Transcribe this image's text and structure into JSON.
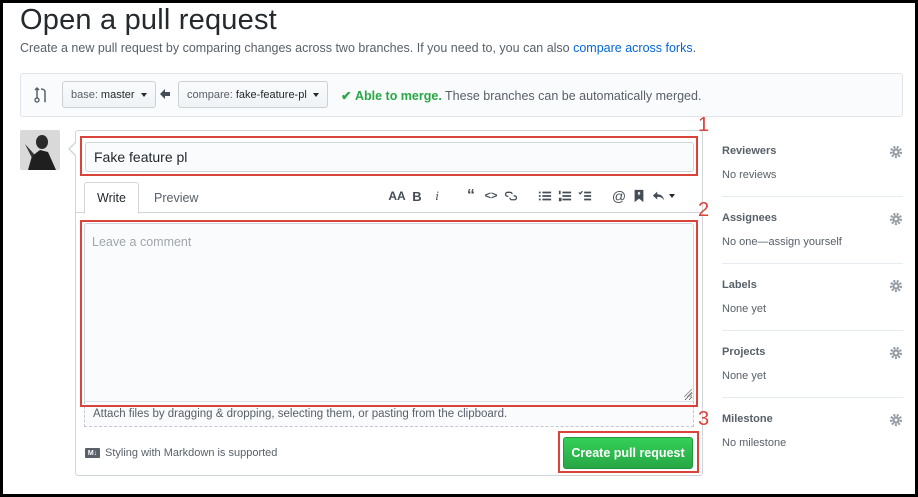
{
  "header": {
    "title": "Open a pull request",
    "subtitle": "Create a new pull request by comparing changes across two branches. If you need to, you can also ",
    "subtitle_link": "compare across forks",
    "subtitle_end": "."
  },
  "compare": {
    "base_prefix": "base:",
    "base_branch": "master",
    "compare_prefix": "compare:",
    "compare_branch": "fake-feature-pl",
    "merge_ok": "Able to merge.",
    "merge_msg": "These branches can be automatically merged."
  },
  "form": {
    "title_value": "Fake feature pl",
    "tabs": [
      {
        "label": "Write"
      },
      {
        "label": "Preview"
      }
    ],
    "comment_placeholder": "Leave a comment",
    "attach_text": "Attach files by dragging & dropping, selecting them, or pasting from the clipboard.",
    "markdown_note": "Styling with Markdown is supported",
    "submit_label": "Create pull request",
    "toolbar": [
      "header-icon",
      "bold-icon",
      "italic-icon",
      "quote-icon",
      "code-icon",
      "link-icon",
      "bulleted-list-icon",
      "numbered-list-icon",
      "task-list-icon",
      "mention-icon",
      "bookmark-icon",
      "reply-icon"
    ]
  },
  "annotations": [
    "1",
    "2",
    "3"
  ],
  "sidebar": {
    "sections": [
      {
        "label": "Reviewers",
        "value": "No reviews"
      },
      {
        "label": "Assignees",
        "value": "No one—assign yourself"
      },
      {
        "label": "Labels",
        "value": "None yet"
      },
      {
        "label": "Projects",
        "value": "None yet"
      },
      {
        "label": "Milestone",
        "value": "No milestone"
      }
    ]
  },
  "colors": {
    "accent_link": "#0366d6",
    "success": "#28a745",
    "annotation": "#d9443a"
  }
}
